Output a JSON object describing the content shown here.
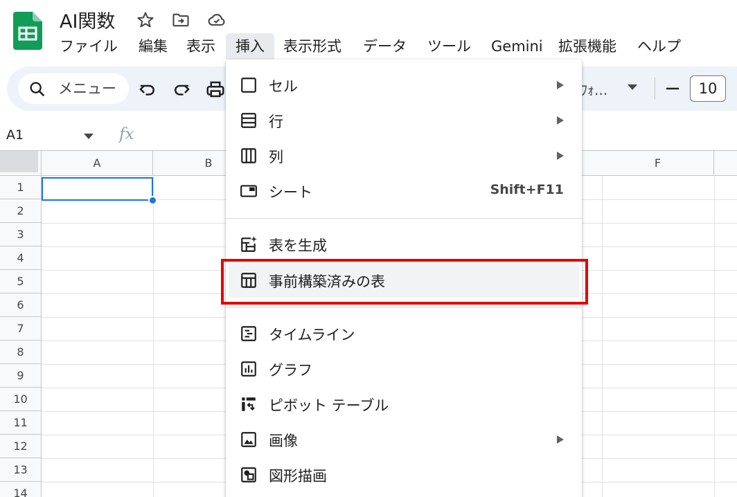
{
  "app": {
    "title": "AI関数",
    "brand_color": "#0f9d58",
    "title_icons": [
      "star-icon",
      "move-to-folder-icon",
      "cloud-saved-icon"
    ]
  },
  "menubar": {
    "items": [
      "ファイル",
      "編集",
      "表示",
      "挿入",
      "表示形式",
      "データ",
      "ツール",
      "Gemini",
      "拡張機能",
      "ヘルプ"
    ],
    "active": "挿入"
  },
  "toolbar": {
    "search_label": "メニュー",
    "font_name": "ﾌｫ...",
    "font_size": "10",
    "icons": [
      "undo-icon",
      "redo-icon",
      "print-icon"
    ]
  },
  "formula_bar": {
    "name_box": "A1",
    "fx_label": "fx"
  },
  "grid": {
    "columns": [
      "A",
      "B",
      "F"
    ],
    "rows": [
      "1",
      "2",
      "3",
      "4",
      "5",
      "6",
      "7",
      "8",
      "9",
      "10",
      "11",
      "12",
      "13",
      "14"
    ],
    "selected_cell": "A1",
    "selection_color": "#1a73e8"
  },
  "insert_menu": {
    "items": [
      {
        "label": "セル",
        "icon": "cell-icon",
        "submenu": true
      },
      {
        "label": "行",
        "icon": "rows-icon",
        "submenu": true
      },
      {
        "label": "列",
        "icon": "columns-icon",
        "submenu": true
      },
      {
        "label": "シート",
        "icon": "sheet-icon",
        "shortcut": "Shift+F11"
      },
      {
        "label": "表を生成",
        "icon": "generate-table-icon"
      },
      {
        "label": "事前構築済みの表",
        "icon": "prebuilt-table-icon",
        "highlighted": true
      },
      {
        "label": "タイムライン",
        "icon": "timeline-icon"
      },
      {
        "label": "グラフ",
        "icon": "chart-icon"
      },
      {
        "label": "ピボット テーブル",
        "icon": "pivot-table-icon"
      },
      {
        "label": "画像",
        "icon": "image-icon",
        "submenu": true
      },
      {
        "label": "図形描画",
        "icon": "drawing-icon"
      }
    ],
    "highlight_color": "#e60000"
  }
}
